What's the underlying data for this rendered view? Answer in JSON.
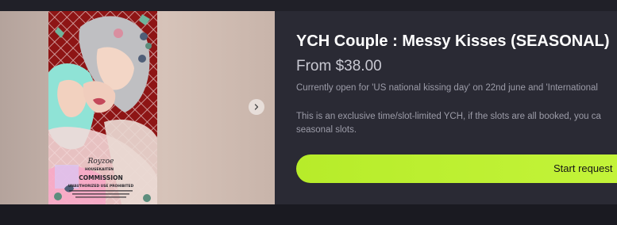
{
  "listing": {
    "title": "YCH Couple : Messy Kisses (SEASONAL)",
    "price": "From $38.00",
    "description_1": "Currently open for 'US national kissing day' on 22nd june and 'International",
    "description_2": "This is an exclusive time/slot-limited YCH, if the slots are all booked, you ca seasonal slots.",
    "cta_label": "Start request"
  },
  "gallery": {
    "next_icon": "chevron-right-icon",
    "artwork_text": {
      "signature": "Royzoe",
      "studio": "HOUSEKAITEN",
      "commission": "COMMISSION",
      "warning": "UNAUTHORIZED USE PROHIBITED"
    }
  },
  "colors": {
    "accent": "#c4f43a",
    "background": "#212129",
    "card": "#2a2a34",
    "artwork_red": "#8e1515"
  }
}
